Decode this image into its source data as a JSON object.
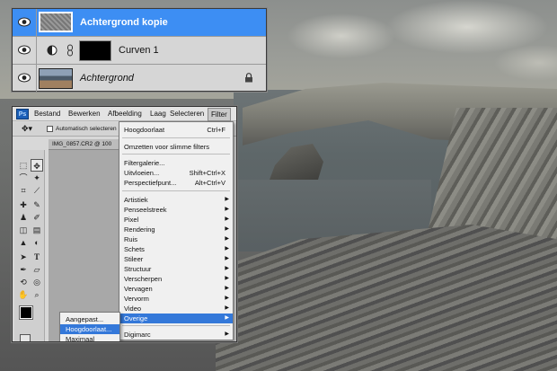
{
  "layers_panel": {
    "layers": [
      {
        "name": "Achtergrond kopie",
        "selected": true,
        "italic": false,
        "bold": true,
        "locked": false,
        "type": "pixel",
        "visible": true
      },
      {
        "name": "Curven 1",
        "selected": false,
        "italic": false,
        "bold": false,
        "locked": false,
        "type": "adjustment",
        "visible": true
      },
      {
        "name": "Achtergrond",
        "selected": false,
        "italic": true,
        "bold": false,
        "locked": true,
        "type": "pixel",
        "visible": true
      }
    ]
  },
  "photoshop": {
    "logo": "Ps",
    "menu": [
      "Bestand",
      "Bewerken",
      "Afbeelding",
      "Laag",
      "Selecteren",
      "Filter"
    ],
    "active_menu": "Filter",
    "options_bar": {
      "auto_select_label": "Automatisch selecteren"
    },
    "document_tab": "IMG_0857.CR2 @ 100",
    "filter_menu": {
      "items": [
        {
          "label": "Hoogdoorlaat",
          "shortcut": "Ctrl+F"
        },
        {
          "label": "Omzetten voor slimme filters"
        },
        {
          "label": "Filtergalerie..."
        },
        {
          "label": "Uitvloeien...",
          "shortcut": "Shift+Ctrl+X"
        },
        {
          "label": "Perspectiefpunt...",
          "shortcut": "Alt+Ctrl+V"
        },
        {
          "label": "Artistiek",
          "submenu": true
        },
        {
          "label": "Penseelstreek",
          "submenu": true
        },
        {
          "label": "Pixel",
          "submenu": true
        },
        {
          "label": "Rendering",
          "submenu": true
        },
        {
          "label": "Ruis",
          "submenu": true
        },
        {
          "label": "Schets",
          "submenu": true
        },
        {
          "label": "Stileer",
          "submenu": true
        },
        {
          "label": "Structuur",
          "submenu": true
        },
        {
          "label": "Verscherpen",
          "submenu": true
        },
        {
          "label": "Vervagen",
          "submenu": true
        },
        {
          "label": "Vervorm",
          "submenu": true
        },
        {
          "label": "Video",
          "submenu": true
        },
        {
          "label": "Overige",
          "submenu": true,
          "highlighted": true
        },
        {
          "label": "Digimarc",
          "submenu": true
        }
      ]
    },
    "submenu": {
      "items": [
        {
          "label": "Aangepast..."
        },
        {
          "label": "Hoogdoorlaat...",
          "highlighted": true
        },
        {
          "label": "Maximaal"
        }
      ]
    }
  },
  "colors": {
    "selection_blue": "#3d8ef3",
    "menu_highlight": "#3478d9",
    "panel_gray": "#d6d6d6"
  }
}
